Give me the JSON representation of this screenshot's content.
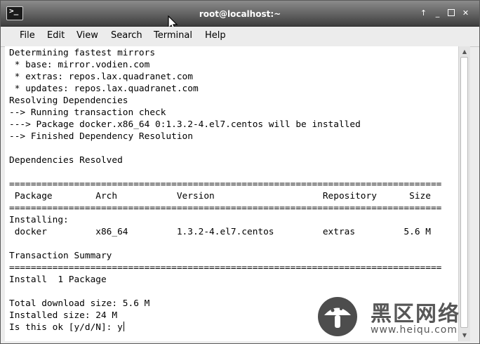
{
  "window": {
    "title": "root@localhost:~",
    "icon": "terminal-icon",
    "controls": [
      "up-arrow-icon",
      "minimize-icon",
      "maximize-icon",
      "close-icon"
    ]
  },
  "menu": [
    "File",
    "Edit",
    "View",
    "Search",
    "Terminal",
    "Help"
  ],
  "terminal": {
    "lines": [
      "Determining fastest mirrors",
      " * base: mirror.vodien.com",
      " * extras: repos.lax.quadranet.com",
      " * updates: repos.lax.quadranet.com",
      "Resolving Dependencies",
      "--> Running transaction check",
      "---> Package docker.x86_64 0:1.3.2-4.el7.centos will be installed",
      "--> Finished Dependency Resolution",
      "",
      "Dependencies Resolved",
      "",
      "================================================================================",
      " Package        Arch           Version                    Repository      Size",
      "================================================================================",
      "Installing:",
      " docker         x86_64         1.3.2-4.el7.centos         extras         5.6 M",
      "",
      "Transaction Summary",
      "================================================================================",
      "Install  1 Package",
      "",
      "Total download size: 5.6 M",
      "Installed size: 24 M"
    ],
    "prompt": "Is this ok [y/d/N]: y"
  },
  "watermark": {
    "chinese": "黑区网络",
    "url": "www.heiqu.com"
  }
}
